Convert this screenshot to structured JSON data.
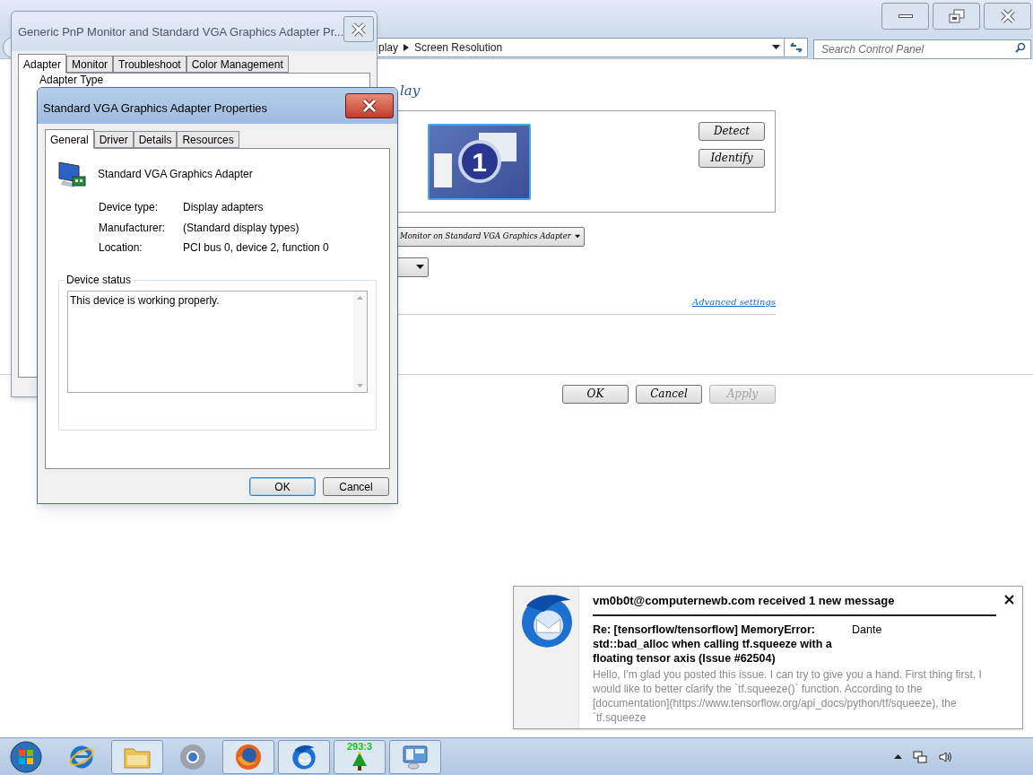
{
  "control_panel": {
    "breadcrumb": [
      "play",
      "Screen Resolution"
    ],
    "search": {
      "placeholder": "Search Control Panel"
    },
    "heading": "lay",
    "monitor_number": "1",
    "side_buttons": [
      "Detect",
      "Identify"
    ],
    "display_select": "Monitor on Standard VGA Graphics Adapter",
    "advanced_link": "Advanced settings",
    "buttons": [
      {
        "label": "OK",
        "disabled": false
      },
      {
        "label": "Cancel",
        "disabled": false
      },
      {
        "label": "Apply",
        "disabled": true
      }
    ]
  },
  "monitor_dialog": {
    "title": "Generic PnP Monitor and Standard VGA Graphics Adapter Pr...",
    "tabs": [
      {
        "label": "Adapter",
        "selected": true
      },
      {
        "label": "Monitor",
        "selected": false
      },
      {
        "label": "Troubleshoot",
        "selected": false
      },
      {
        "label": "Color Management",
        "selected": false
      }
    ],
    "group_label": "Adapter Type"
  },
  "adapter_dialog": {
    "title": "Standard VGA Graphics Adapter Properties",
    "tabs": [
      {
        "label": "General",
        "selected": true
      },
      {
        "label": "Driver",
        "selected": false
      },
      {
        "label": "Details",
        "selected": false
      },
      {
        "label": "Resources",
        "selected": false
      }
    ],
    "device_name": "Standard VGA Graphics Adapter",
    "properties": [
      {
        "label": "Device type:",
        "value": "Display adapters"
      },
      {
        "label": "Manufacturer:",
        "value": "(Standard display types)"
      },
      {
        "label": "Location:",
        "value": "PCI bus 0, device 2, function 0"
      }
    ],
    "status_label": "Device status",
    "status_text": "This device is working properly.",
    "buttons": [
      {
        "label": "OK",
        "default": true
      },
      {
        "label": "Cancel",
        "default": false
      }
    ]
  },
  "notification": {
    "title": "vm0b0t@computernewb.com received 1 new message",
    "subject": "Re: [tensorflow/tensorflow] MemoryError: std::bad_alloc when calling tf.squeeze with a floating tensor axis (Issue #62504)",
    "sender": "Dante",
    "preview": "Hello, I'm glad you posted this issue. I can try to give you a hand. First thing first, I would like to better clarify the `tf.squeeze()` function. According to the [documentation](https://www.tensorflow.org/api_docs/python/tf/squeeze), the `tf.squeeze"
  },
  "taskbar": {
    "items": [
      {
        "open": false
      },
      {
        "open": false
      },
      {
        "open": true
      },
      {
        "open": false
      },
      {
        "open": true
      },
      {
        "open": true
      },
      {
        "open": true,
        "label": "293:3"
      },
      {
        "open": true
      }
    ]
  }
}
